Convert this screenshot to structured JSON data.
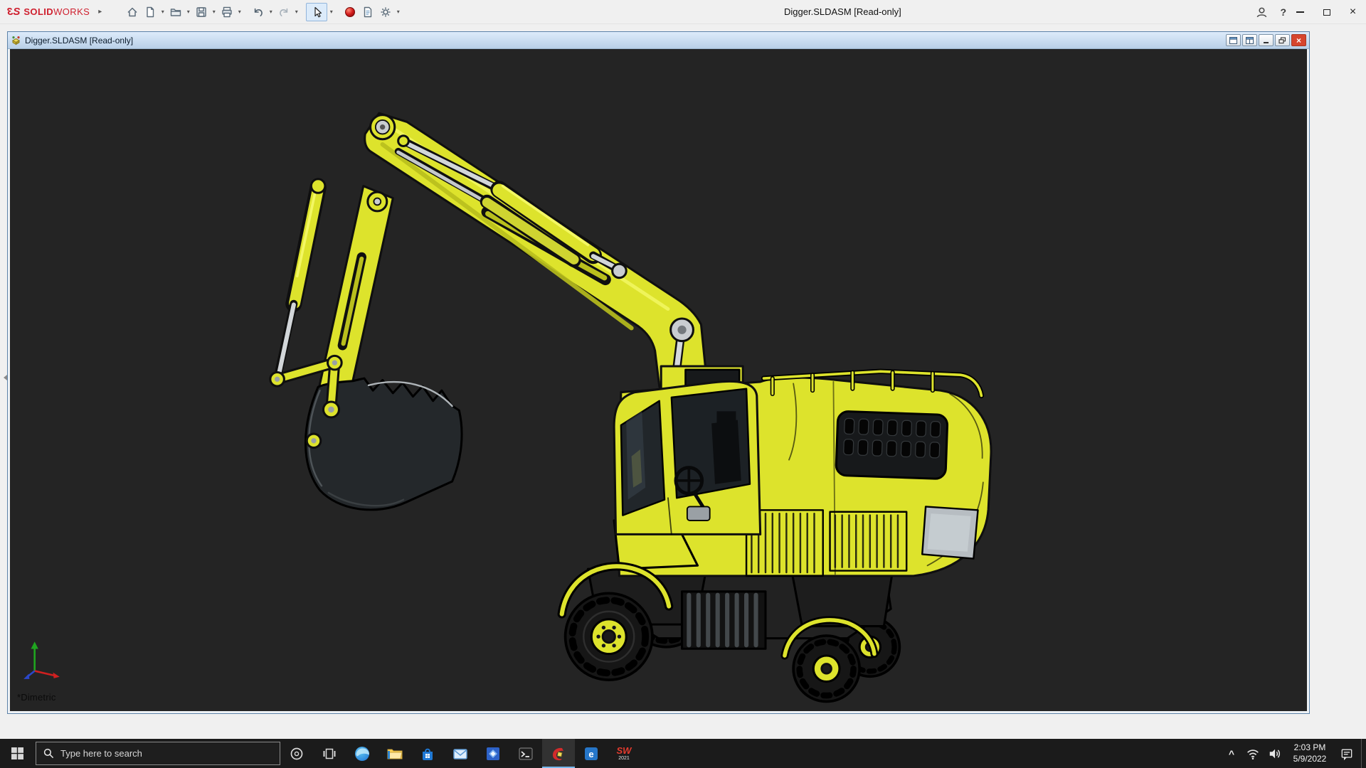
{
  "app": {
    "brand": {
      "logo_left": "3",
      "logo_right": "S",
      "solid": "SOLID",
      "works": "WORKS"
    },
    "title": "Digger.SLDASM [Read-only]"
  },
  "glyphs": {
    "flyout": "▸",
    "dropdown": "▾",
    "help": "?",
    "close": "×",
    "tray_expand": "^"
  },
  "toolbar_icons": [
    "home",
    "new-document",
    "open",
    "save",
    "print",
    "undo",
    "redo",
    "select-cursor",
    "rebuild-red-ball",
    "file-properties",
    "options-gear"
  ],
  "doc_window": {
    "title": "Digger.SLDASM [Read-only]"
  },
  "viewport": {
    "view_label": "*Dimetric",
    "background": "#242424",
    "model_color": "#dde32c",
    "model_name": "Digger excavator assembly"
  },
  "taskbar": {
    "search_placeholder": "Type here to search",
    "pinned_apps": [
      "edge",
      "file-explorer",
      "store",
      "mail",
      "photos",
      "terminal",
      "solidworks",
      "edrawings",
      "solidworks-2021"
    ],
    "active_app": "solidworks",
    "icons": {
      "edrawings_letter": "e",
      "sw2021_top": "SW",
      "sw2021_year": "2021"
    },
    "tray": {
      "time": "2:03 PM",
      "date": "5/9/2022"
    }
  }
}
